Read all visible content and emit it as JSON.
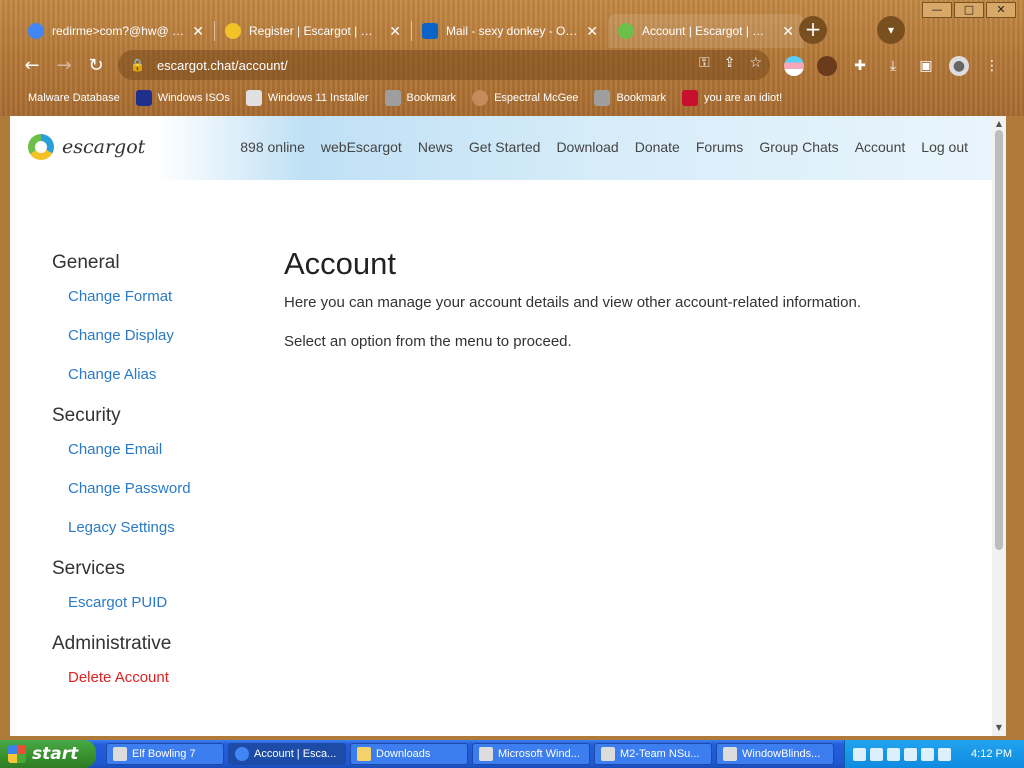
{
  "browser": {
    "tabs": [
      {
        "title": "redirme>com?@hw@ - Go",
        "favicon_color": "#4285f4",
        "active": false
      },
      {
        "title": "Register | Escargot | MSN",
        "favicon_color": "#f3c227",
        "active": false
      },
      {
        "title": "Mail - sexy donkey - Outlook",
        "favicon_color": "#0a64c8",
        "active": false
      },
      {
        "title": "Account | Escargot | MSN",
        "favicon_color": "#6cc04a",
        "active": true
      }
    ],
    "url": "escargot.chat/account/",
    "bookmarks": [
      {
        "label": "Malware Database",
        "icon_color": "#b07a3a"
      },
      {
        "label": "Windows ISOs",
        "icon_color": "#1e2f8c"
      },
      {
        "label": "Windows 11 Installer",
        "icon_color": "#e0e0e0"
      },
      {
        "label": "Bookmark",
        "icon_color": "#9e9e9e"
      },
      {
        "label": "Espectral McGee",
        "icon_color": "#c58b5a"
      },
      {
        "label": "Bookmark",
        "icon_color": "#9e9e9e"
      },
      {
        "label": "you are an idiot!",
        "icon_color": "#c8102e"
      }
    ]
  },
  "site": {
    "brand": "escargot",
    "nav": [
      "898 online",
      "webEscargot",
      "News",
      "Get Started",
      "Download",
      "Donate",
      "Forums",
      "Group Chats",
      "Account",
      "Log out"
    ]
  },
  "sidebar": {
    "groups": [
      {
        "title": "General",
        "items": [
          "Change Format",
          "Change Display",
          "Change Alias"
        ]
      },
      {
        "title": "Security",
        "items": [
          "Change Email",
          "Change Password",
          "Legacy Settings"
        ]
      },
      {
        "title": "Services",
        "items": [
          "Escargot PUID"
        ]
      },
      {
        "title": "Administrative",
        "items": [
          "Delete Account"
        ]
      }
    ]
  },
  "main": {
    "heading": "Account",
    "intro": "Here you can manage your account details and view other account-related information.",
    "prompt": "Select an option from the menu to proceed."
  },
  "taskbar": {
    "start_label": "start",
    "tasks": [
      {
        "label": "Elf Bowling 7",
        "active": false
      },
      {
        "label": "Account | Esca...",
        "active": true
      },
      {
        "label": "Downloads",
        "active": false
      },
      {
        "label": "Microsoft Wind...",
        "active": false
      },
      {
        "label": "M2-Team NSu...",
        "active": false
      },
      {
        "label": "WindowBlinds...",
        "active": false
      }
    ],
    "clock": "4:12 PM"
  },
  "colors": {
    "link": "#2a7ac7",
    "danger": "#d22222",
    "taskbar_blue": "#245edb",
    "start_green": "#39932f"
  }
}
